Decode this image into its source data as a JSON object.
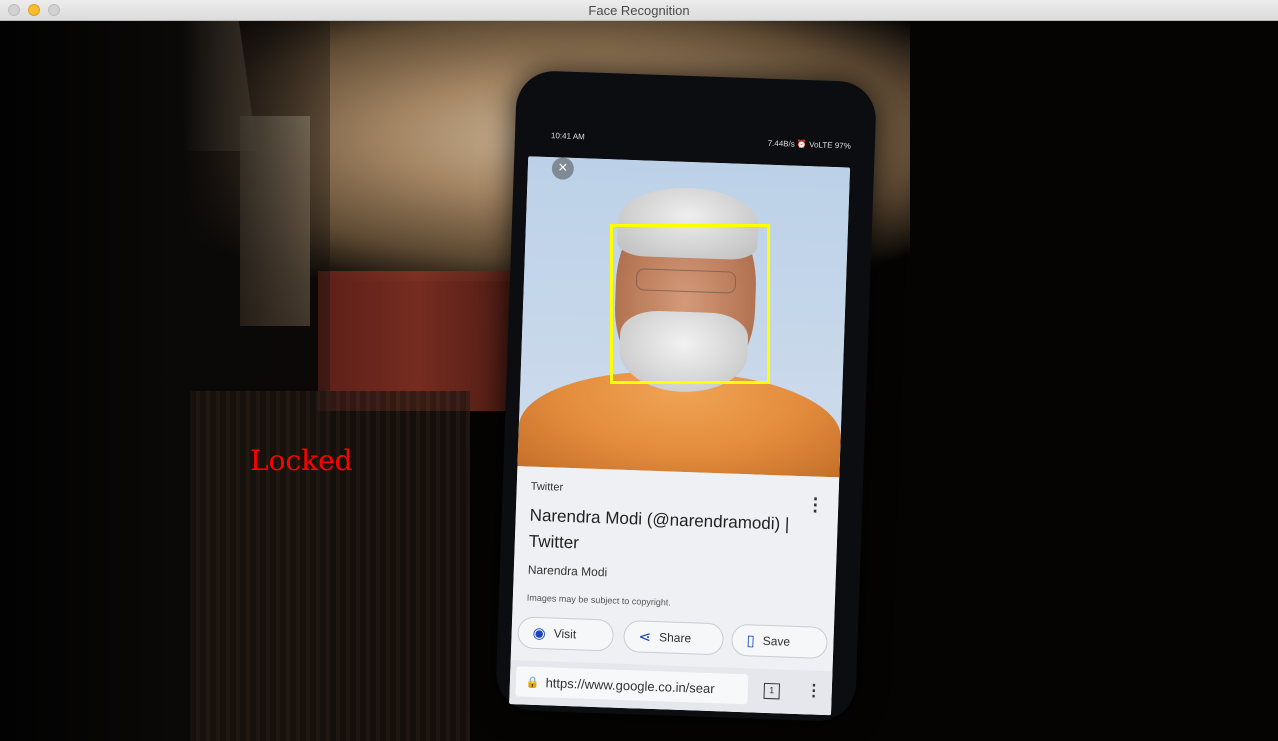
{
  "window": {
    "title": "Face Recognition"
  },
  "overlay": {
    "status_text": "Locked",
    "status_color": "#ff0000",
    "face_box_color": "#ffff00"
  },
  "phone": {
    "status_time": "10:41 AM",
    "status_right": "7.44B/s ⏰ VoLTE 97%",
    "card": {
      "source": "Twitter",
      "title": "Narendra Modi (@narendramodi) | Twitter",
      "subtitle": "Narendra Modi",
      "note": "Images may be subject to copyright.",
      "actions": [
        {
          "label": "Visit",
          "icon": "globe-icon"
        },
        {
          "label": "Share",
          "icon": "share-icon"
        },
        {
          "label": "Save",
          "icon": "bookmark-icon"
        }
      ]
    },
    "browser": {
      "url": "https://www.google.co.in/sear",
      "tab_count": "1"
    }
  }
}
